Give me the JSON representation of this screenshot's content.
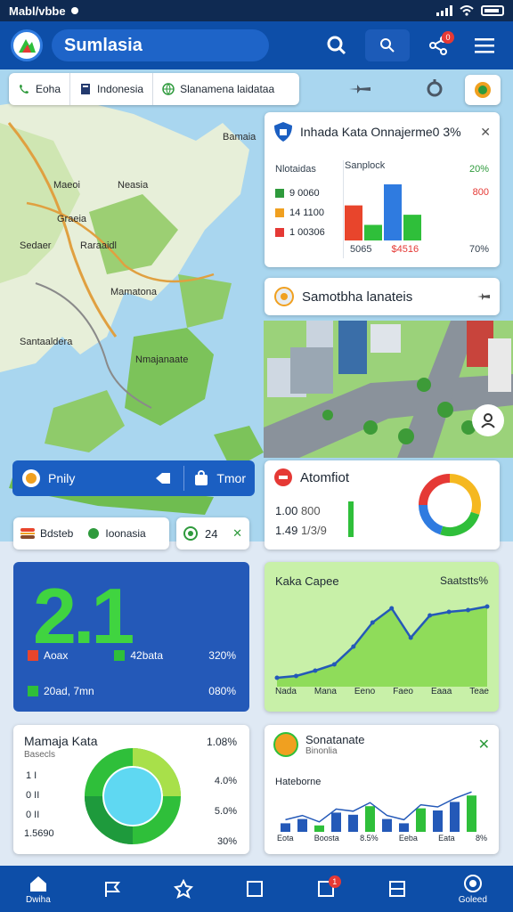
{
  "status": {
    "carrier": "Mabl/vbbe"
  },
  "app": {
    "title": "Sumlasia",
    "notification_count": "0",
    "share_count": "0"
  },
  "map_chips": [
    {
      "label": "Eoha"
    },
    {
      "label": "Indonesia"
    },
    {
      "label": "Slanamena laidataa"
    }
  ],
  "map_labels": {
    "l1": "Bamaia",
    "l2": "Maeoi",
    "l3": "Neasia",
    "l4": "Graeia",
    "l5": "Sedaer",
    "l6": "Raraaidl",
    "l7": "Mamatona",
    "l8": "Santaaldera",
    "l9": "Nmajanaate"
  },
  "card_data": {
    "title": "Inhada Kata Onnajerme0 3%",
    "col_left": "Nlotaidas",
    "col_mid": "Sanplock",
    "rows": [
      {
        "value": "9 0060",
        "color": "#2e9a3c"
      },
      {
        "value": "14 1100",
        "color": "#f0a020"
      },
      {
        "value": "1 00306",
        "color": "#e53935"
      }
    ],
    "right_values": [
      "20%",
      "800",
      "70%"
    ],
    "bar_footer": [
      "5065",
      "$4516"
    ],
    "bars": [
      {
        "value": 45,
        "color": "#e8452c"
      },
      {
        "value": 20,
        "color": "#2fbf3a"
      },
      {
        "value": 72,
        "color": "#2f7be0"
      },
      {
        "value": 33,
        "color": "#2fbf3a"
      }
    ]
  },
  "search_card": {
    "title": "Samotbha lanateis"
  },
  "blue_bar": {
    "left": "Pnily",
    "right": "Tmor"
  },
  "filter_chips": [
    {
      "label": "Bdsteb"
    },
    {
      "label": "Ioonasia"
    }
  ],
  "count_chip": {
    "value": "24"
  },
  "donut_card": {
    "title": "Atomfiot",
    "rows": [
      {
        "a": "1.00",
        "b": "800"
      },
      {
        "a": "1.49",
        "b": "1/3/9"
      }
    ],
    "slices": [
      {
        "value": 30,
        "color": "#f5b820"
      },
      {
        "value": 25,
        "color": "#2fbf3a"
      },
      {
        "value": 20,
        "color": "#2f7be0"
      },
      {
        "value": 25,
        "color": "#e53935"
      }
    ]
  },
  "big_card": {
    "number": "2.1",
    "rows": [
      {
        "label": "Aoax",
        "color": "#e8452c",
        "label2": "42bata",
        "color2": "#2fbf3a",
        "pct": "320%"
      },
      {
        "label": "20ad, 7mn",
        "color": "#2fbf3a",
        "pct": "080%"
      }
    ]
  },
  "line_card": {
    "title": "Kaka Capee",
    "subtitle": "Saatstts%",
    "x_labels": [
      "Nada",
      "Mana",
      "Eeno",
      "Faeo",
      "Eaaa",
      "Teae"
    ],
    "values": [
      10,
      12,
      18,
      25,
      45,
      72,
      88,
      55,
      80,
      84,
      86,
      90
    ]
  },
  "ring_card": {
    "title": "Mamaja Kata",
    "pct_top": "1.08%",
    "subtitle": "Basecls",
    "left_rows": [
      "1 I",
      "0 II",
      "0 II"
    ],
    "left_bottom": "1.5690",
    "right_values": [
      "4.0%",
      "5.0%",
      "30%"
    ]
  },
  "bar_card": {
    "title": "Sonatanate",
    "subtitle": "Binonlia",
    "chart_title": "Hateborne",
    "x_labels": [
      "Eota",
      "Boosta",
      "8.5%",
      "Eeba",
      "Eata",
      "8%"
    ],
    "bars": [
      20,
      30,
      15,
      45,
      40,
      60,
      30,
      20,
      55,
      50,
      70,
      85
    ]
  },
  "nav": [
    {
      "label": "Dwiha",
      "icon": "home-icon"
    },
    {
      "label": "",
      "icon": "flag-icon"
    },
    {
      "label": "",
      "icon": "star-icon"
    },
    {
      "label": "",
      "icon": "square-icon"
    },
    {
      "label": "",
      "icon": "message-icon",
      "badge": "1"
    },
    {
      "label": "",
      "icon": "layers-icon"
    },
    {
      "label": "Goleed",
      "icon": "profile-icon"
    }
  ]
}
